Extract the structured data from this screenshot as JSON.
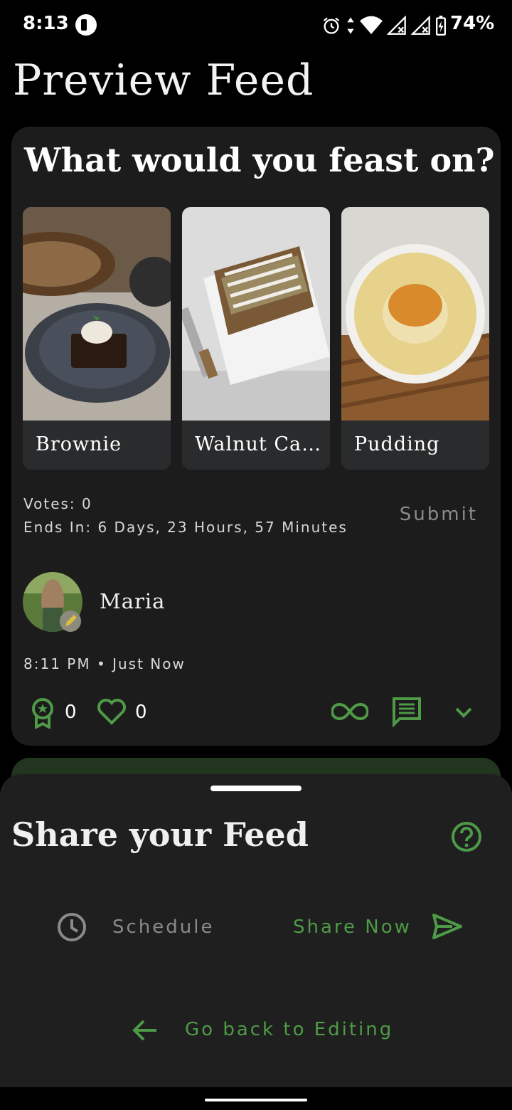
{
  "status_bar": {
    "time": "8:13",
    "battery_percent": "74%",
    "icons": [
      "app-notification-icon",
      "alarm-icon",
      "data-arrows-icon",
      "wifi-icon",
      "signal-icon",
      "signal-icon",
      "battery-charging-icon"
    ]
  },
  "page": {
    "title": "Preview Feed"
  },
  "poll": {
    "question": "What would you feast on?",
    "options": [
      {
        "label": "Brownie",
        "image": "brownie-photo"
      },
      {
        "label": "Walnut Ca…",
        "image": "walnut-cake-photo"
      },
      {
        "label": "Pudding",
        "image": "pudding-photo"
      }
    ],
    "votes": "Votes: 0",
    "ends_in": "Ends In: 6 Days, 23 Hours, 57 Minutes",
    "submit_label": "Submit",
    "author": "Maria",
    "timestamp": "8:11 PM • Just Now",
    "awards_count": "0",
    "likes_count": "0"
  },
  "share_sheet": {
    "title": "Share your Feed",
    "schedule_label": "Schedule",
    "share_now_label": "Share Now",
    "back_label": "Go back to Editing"
  },
  "colors": {
    "accent_green": "#4e9a47",
    "card_bg": "#1c1c1c",
    "sheet_bg": "#1f1f1f"
  }
}
